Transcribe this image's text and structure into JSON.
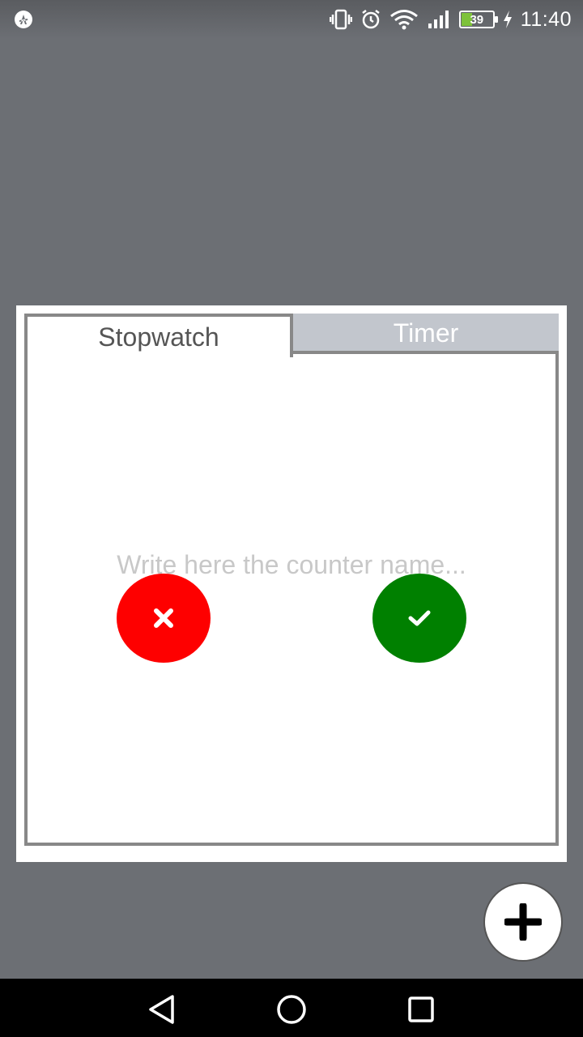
{
  "status_bar": {
    "time": "11:40",
    "battery_level": "39",
    "battery_fraction": 0.39,
    "icons": [
      "notification-app-icon",
      "vibrate-icon",
      "alarm-icon",
      "wifi-icon",
      "signal-icon",
      "battery-icon",
      "charging-icon"
    ]
  },
  "dialog": {
    "tabs": [
      {
        "label": "Stopwatch",
        "selected": true
      },
      {
        "label": "Timer",
        "selected": false
      }
    ],
    "counter_name": {
      "value": "",
      "placeholder": "Write here the counter name..."
    },
    "cancel_button": {
      "icon": "close-icon",
      "color": "#fe0000"
    },
    "confirm_button": {
      "icon": "check-icon",
      "color": "#008000"
    }
  },
  "fab": {
    "icon": "plus-icon"
  },
  "nav_bar": {
    "buttons": [
      "back-icon",
      "home-icon",
      "recents-icon"
    ]
  },
  "colors": {
    "background": "#6c6f74",
    "tab_inactive": "#c2c6cd",
    "border": "#888888"
  }
}
